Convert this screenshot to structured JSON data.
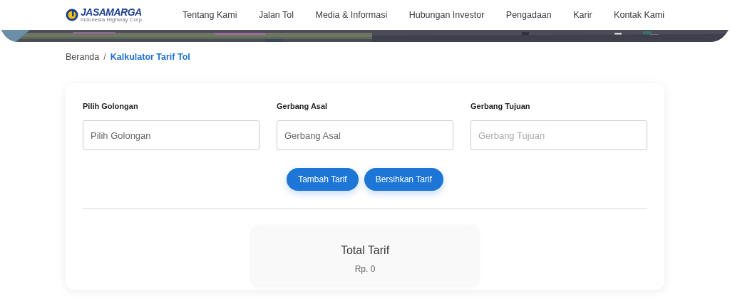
{
  "header": {
    "logo": {
      "name": "JASAMARGA",
      "tagline": "Indonesia Highway Corp."
    },
    "nav": [
      "Tentang Kami",
      "Jalan Tol",
      "Media & Informasi",
      "Hubungan Investor",
      "Pengadaan",
      "Karir",
      "Kontak Kami"
    ]
  },
  "breadcrumb_separator": "/",
  "breadcrumb": [
    {
      "label": "Beranda",
      "current": false
    },
    {
      "label": "Kalkulator Tarif Tol",
      "current": true
    }
  ],
  "form": {
    "fields": [
      {
        "label": "Pilih Golongan",
        "placeholder": "Pilih Golongan",
        "disabled": false
      },
      {
        "label": "Gerbang Asal",
        "placeholder": "Gerbang Asal",
        "disabled": false
      },
      {
        "label": "Gerbang Tujuan",
        "placeholder": "Gerbang Tujuan",
        "disabled": true
      }
    ],
    "buttons": [
      "Tambah Tarif",
      "Bersihkan Tarif"
    ],
    "total": {
      "title": "Total Tarif",
      "value": "Rp. 0"
    }
  }
}
